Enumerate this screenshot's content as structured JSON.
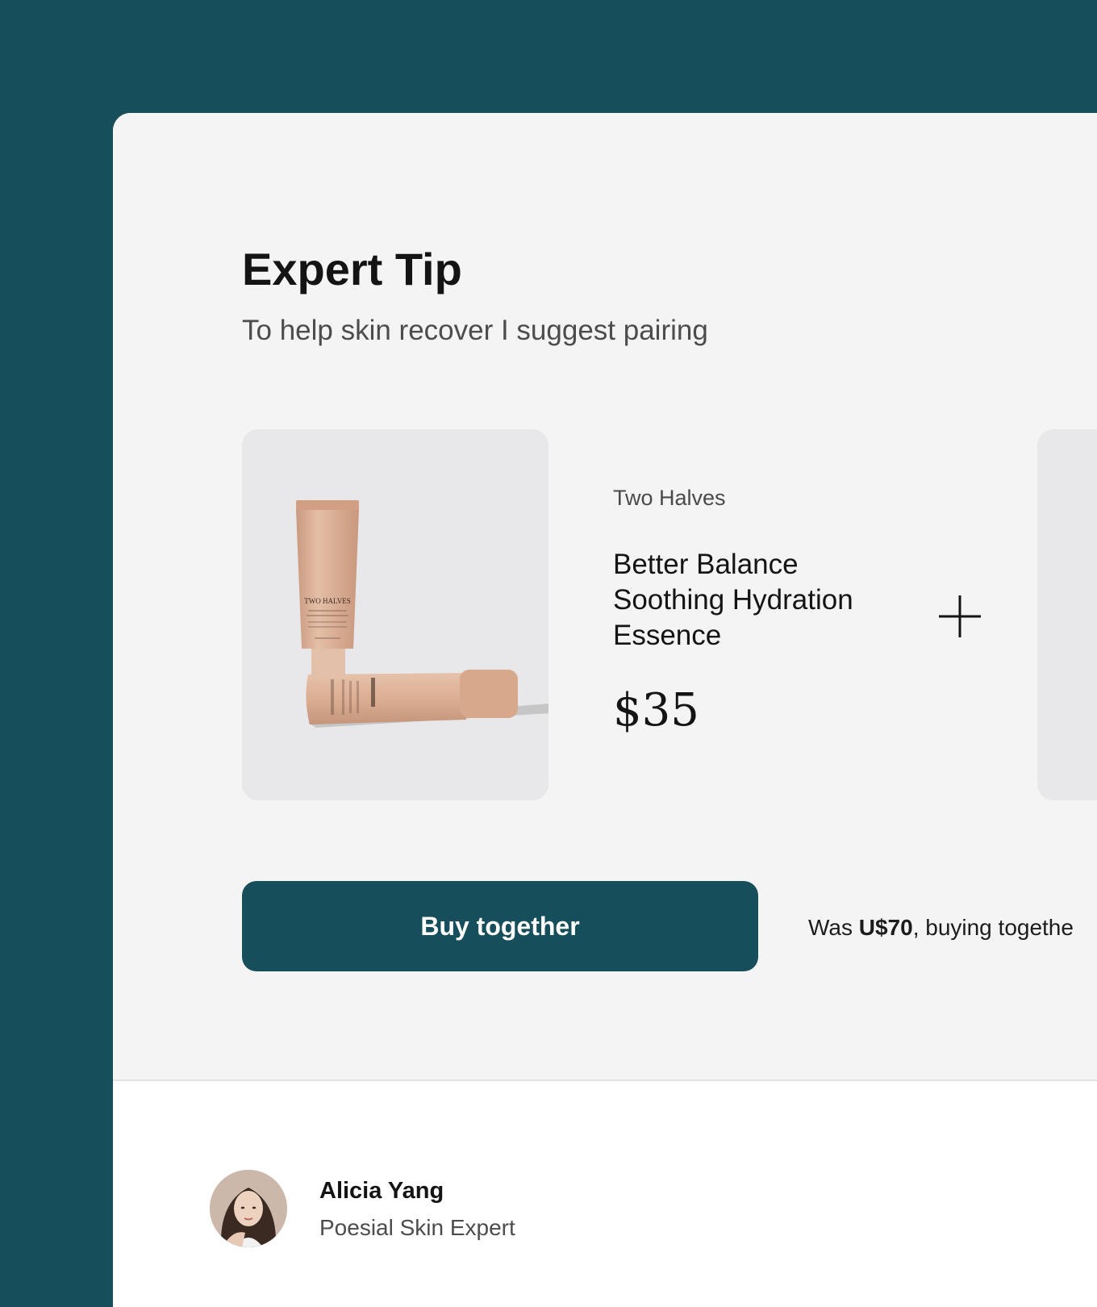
{
  "colors": {
    "page_background": "#164e5b",
    "card_background": "#ffffff",
    "tip_background": "#f4f4f4",
    "tile_background": "#e8e8ea",
    "accent": "#164e5b",
    "product_tube": "#dcae93"
  },
  "tip": {
    "title": "Expert Tip",
    "subtitle": "To help skin recover I suggest pairing"
  },
  "products": [
    {
      "brand": "Two Halves",
      "name": "Better Balance Soothing Hydration Essence",
      "price": "$35",
      "package_brand_text": "TWO HALVES",
      "image_icon": "product-tubes-image"
    },
    {
      "image_icon": "product-tube-image"
    }
  ],
  "pairing": {
    "icon": "plus-icon"
  },
  "actions": {
    "buy_label": "Buy together",
    "savings_prefix": "Was ",
    "savings_amount": "U$70",
    "savings_suffix": ", buying togethe"
  },
  "expert": {
    "name": "Alicia Yang",
    "role": "Poesial Skin Expert",
    "avatar_icon": "avatar-photo"
  }
}
